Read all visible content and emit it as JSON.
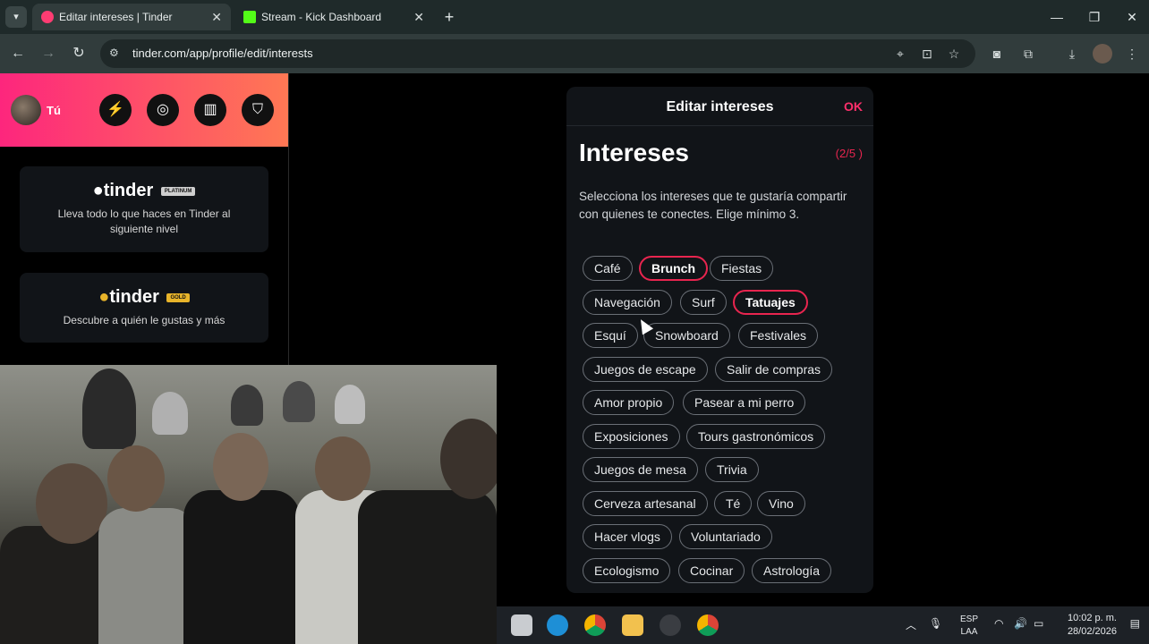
{
  "browser": {
    "tabs": [
      {
        "title": "Editar intereses | Tinder",
        "active": true,
        "icon": "tinder-flame-icon",
        "color": "#fe3c72"
      },
      {
        "title": "Stream - Kick Dashboard",
        "active": false,
        "icon": "kick-logo-icon",
        "color": "#53fc18"
      }
    ],
    "url": "tinder.com/app/profile/edit/interests"
  },
  "sidebar": {
    "user_label": "Tú",
    "promos": [
      {
        "brand": "tinder",
        "badge": "PLATINUM",
        "description": "Lleva todo lo que haces en Tinder al siguiente nivel"
      },
      {
        "brand": "tinder",
        "badge": "GOLD",
        "description": "Descubre a quién le gustas y más"
      }
    ]
  },
  "modal": {
    "title": "Editar intereses",
    "ok_label": "OK",
    "heading": "Intereses",
    "count": "(2/5 )",
    "instructions": "Selecciona los intereses que te gustaría compartir con quienes te conectes. Elige mínimo 3.",
    "interests": [
      {
        "label": "Café",
        "selected": false
      },
      {
        "label": "Brunch",
        "selected": true
      },
      {
        "label": "Fiestas",
        "selected": false
      },
      {
        "label": "Navegación",
        "selected": false
      },
      {
        "label": "Surf",
        "selected": false
      },
      {
        "label": "Tatuajes",
        "selected": true
      },
      {
        "label": "Esquí",
        "selected": false
      },
      {
        "label": "Snowboard",
        "selected": false
      },
      {
        "label": "Festivales",
        "selected": false
      },
      {
        "label": "Juegos de escape",
        "selected": false
      },
      {
        "label": "Salir de compras",
        "selected": false
      },
      {
        "label": "Amor propio",
        "selected": false
      },
      {
        "label": "Pasear a mi perro",
        "selected": false
      },
      {
        "label": "Exposiciones",
        "selected": false
      },
      {
        "label": "Tours gastronómicos",
        "selected": false
      },
      {
        "label": "Juegos de mesa",
        "selected": false
      },
      {
        "label": "Trivia",
        "selected": false
      },
      {
        "label": "Cerveza artesanal",
        "selected": false
      },
      {
        "label": "Té",
        "selected": false
      },
      {
        "label": "Vino",
        "selected": false
      },
      {
        "label": "Hacer vlogs",
        "selected": false
      },
      {
        "label": "Voluntariado",
        "selected": false
      },
      {
        "label": "Ecologismo",
        "selected": false
      },
      {
        "label": "Cocinar",
        "selected": false
      },
      {
        "label": "Astrología",
        "selected": false
      }
    ]
  },
  "taskbar": {
    "language": "ESP",
    "layout": "LAA",
    "time": "10:02 p. m.",
    "date": "28/02/2026"
  },
  "colors": {
    "accent": "#e8254f",
    "gradient_start": "#fd267d",
    "gradient_end": "#ff7854",
    "platinum_badge": "#cfcfcf",
    "gold_badge": "#e8b42a"
  }
}
